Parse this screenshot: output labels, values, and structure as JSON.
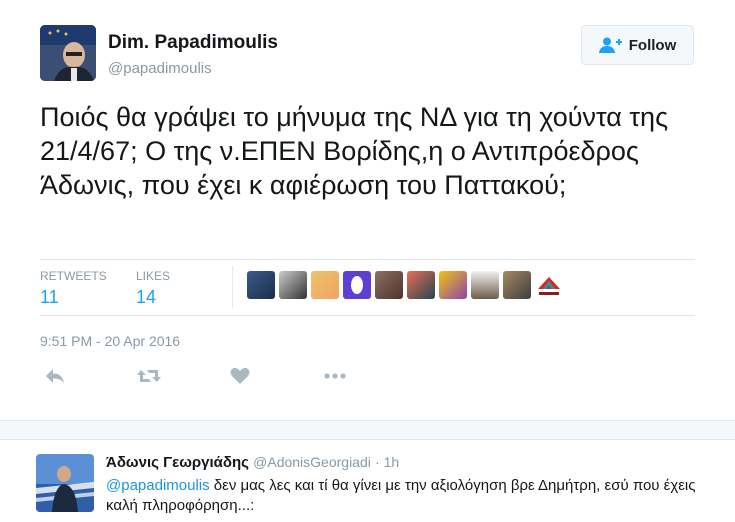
{
  "tweet": {
    "author_name": "Dim. Papadimoulis",
    "author_handle": "@papadimoulis",
    "follow_label": "Follow",
    "text": "Ποιός θα γράψει το μήνυμα της ΝΔ για τη χούντα της 21/4/67; Ο της ν.ΕΠΕΝ Βορίδης,η ο Αντιπρόεδρος Άδωνις, που έχει  κ αφιέρωση του Παττακού;",
    "retweets_label": "RETWEETS",
    "retweets_count": "11",
    "likes_label": "LIKES",
    "likes_count": "14",
    "timestamp": "9:51 PM - 20 Apr 2016",
    "liker_avatars": [
      "user-avatar",
      "user-avatar",
      "user-avatar",
      "user-avatar",
      "user-avatar",
      "user-avatar",
      "user-avatar",
      "user-avatar",
      "user-avatar",
      "syriza-logo"
    ]
  },
  "actions": [
    "reply-icon",
    "retweet-icon",
    "like-icon",
    "more-icon"
  ],
  "reply": {
    "author_name": "Άδωνις Γεωργιάδης",
    "author_handle": "@AdonisGeorgiadi",
    "time": "· 1h",
    "mention": "@papadimoulis",
    "text": " δεν μας λες και τί θα γίνει με την αξιολόγηση βρε Δημήτρη, εσύ που έχεις καλή πληροφόρηση...:"
  },
  "colors": {
    "accent": "#1da1f2",
    "muted": "#8899a6",
    "text": "#14171a",
    "border": "#e1e8ed"
  }
}
